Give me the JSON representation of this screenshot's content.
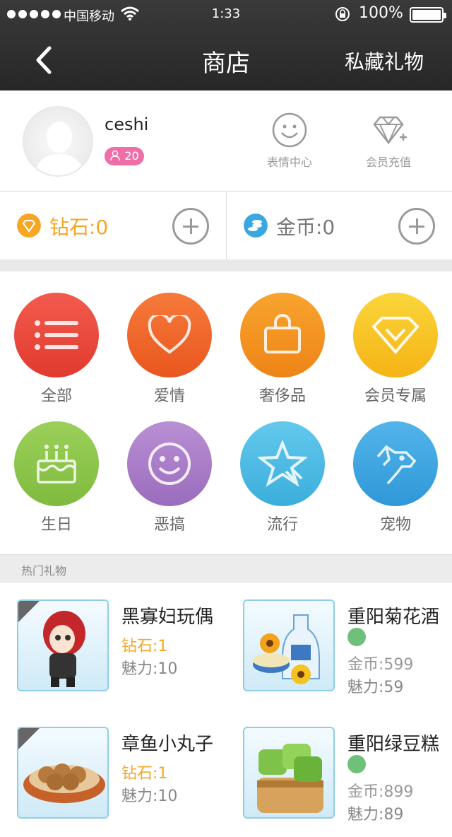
{
  "status": {
    "carrier": "中国移动",
    "time": "1:33",
    "battery": "100%"
  },
  "nav": {
    "title": "商店",
    "right": "私藏礼物"
  },
  "profile": {
    "name": "ceshi",
    "level": "20",
    "quick": [
      {
        "label": "表情中心",
        "icon": "smiley-icon"
      },
      {
        "label": "会员充值",
        "icon": "diamond-plus-icon"
      }
    ]
  },
  "balance": {
    "diamond": "钻石:0",
    "coin": "金币:0",
    "diamond_color": "#f5a623",
    "coin_color": "#3aa8e0"
  },
  "categories": [
    {
      "label": "全部",
      "icon": "list-icon",
      "color": "#e84a3b"
    },
    {
      "label": "爱情",
      "icon": "heart-icon",
      "color": "#ef6a2e"
    },
    {
      "label": "奢侈品",
      "icon": "bag-icon",
      "color": "#f39220"
    },
    {
      "label": "会员专属",
      "icon": "vip-diamond-icon",
      "color": "#f7c41e"
    },
    {
      "label": "生日",
      "icon": "cake-icon",
      "color": "#8bc34a"
    },
    {
      "label": "恶搞",
      "icon": "smiley-icon",
      "color": "#a97ec7"
    },
    {
      "label": "流行",
      "icon": "star-icon",
      "color": "#48b8e3"
    },
    {
      "label": "宠物",
      "icon": "dog-icon",
      "color": "#3aa3de"
    }
  ],
  "section": {
    "title": "热门礼物"
  },
  "gifts": [
    {
      "name": "黑寡妇玩偶",
      "price": "钻石:1",
      "charm": "魅力:10"
    },
    {
      "name": "重阳菊花酒",
      "price": "金币:599",
      "charm": "魅力:59"
    },
    {
      "name": "章鱼小丸子",
      "price": "钻石:1",
      "charm": "魅力:10"
    },
    {
      "name": "重阳绿豆糕",
      "price": "金币:899",
      "charm": "魅力:89"
    }
  ]
}
